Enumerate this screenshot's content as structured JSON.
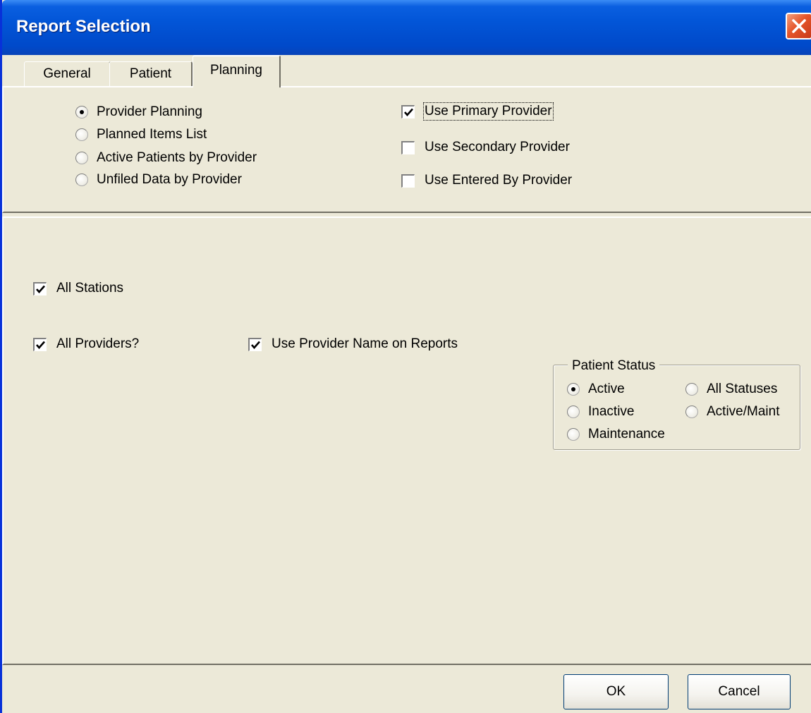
{
  "window": {
    "title": "Report Selection"
  },
  "tabs": [
    {
      "label": "General",
      "active": false
    },
    {
      "label": "Patient",
      "active": false
    },
    {
      "label": "Planning",
      "active": true
    }
  ],
  "report_type": {
    "options": [
      {
        "label": "Provider Planning",
        "checked": true
      },
      {
        "label": "Planned Items List",
        "checked": false
      },
      {
        "label": "Active Patients by Provider",
        "checked": false
      },
      {
        "label": "Unfiled Data by Provider",
        "checked": false
      }
    ]
  },
  "provider_options": [
    {
      "label": "Use Primary Provider",
      "checked": true
    },
    {
      "label": "Use Secondary Provider",
      "checked": false
    },
    {
      "label": "Use Entered By Provider",
      "checked": false
    }
  ],
  "filters": {
    "all_stations": {
      "label": "All Stations",
      "checked": true
    },
    "all_providers": {
      "label": "All Providers?",
      "checked": true
    },
    "use_provider_name": {
      "label": "Use Provider Name on Reports",
      "checked": true
    }
  },
  "patient_status": {
    "title": "Patient Status",
    "options": [
      {
        "label": "Active",
        "checked": true
      },
      {
        "label": "All Statuses",
        "checked": false
      },
      {
        "label": "Inactive",
        "checked": false
      },
      {
        "label": "Active/Maint",
        "checked": false
      },
      {
        "label": "Maintenance",
        "checked": false
      }
    ]
  },
  "buttons": {
    "ok": "OK",
    "cancel": "Cancel"
  },
  "colors": {
    "titlebar": "#0255d7",
    "dialog_bg": "#ece9d8",
    "close_button": "#e5552a"
  }
}
